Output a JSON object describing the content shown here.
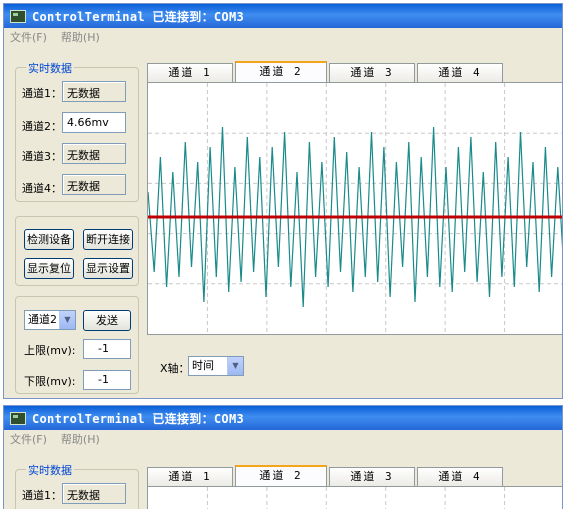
{
  "window": {
    "title": "ControlTerminal 已连接到：COM3",
    "menu": [
      "文件(F)",
      "帮助(H)"
    ]
  },
  "realtime": {
    "group_title": "实时数据",
    "channels": [
      {
        "label": "通道1：",
        "value": "无数据"
      },
      {
        "label": "通道2：",
        "value": "4.66mv"
      },
      {
        "label": "通道3：",
        "value": "无数据"
      },
      {
        "label": "通道4：",
        "value": "无数据"
      }
    ]
  },
  "buttons": {
    "detect": "检测设备",
    "disconnect": "断开连接",
    "reset_display": "显示复位",
    "display_settings": "显示设置",
    "send": "发送"
  },
  "controls": {
    "channel_select": "通道2",
    "upper_label": "上限(mv):",
    "upper_value": "-1",
    "lower_label": "下限(mv):",
    "lower_value": "-1"
  },
  "tabs": [
    "通道 1",
    "通道 2",
    "通道 3",
    "通道 4"
  ],
  "active_tab": 1,
  "xaxis": {
    "label": "X轴：",
    "value": "时间"
  },
  "colors": {
    "signal": "#1a8a8a",
    "baseline": "#c00000",
    "accent_tab": "#f4a51b"
  },
  "chart_data": {
    "type": "line",
    "series": [
      {
        "values": [
          0.25,
          -0.55,
          0.6,
          -0.7,
          0.45,
          -0.6,
          0.75,
          -0.5,
          0.55,
          -0.85,
          0.7,
          -0.6,
          0.9,
          -0.75,
          0.5,
          -0.65,
          0.8,
          -0.55,
          0.6,
          -0.8,
          0.7,
          -0.5,
          0.85,
          -0.7,
          0.45,
          -0.9,
          0.75,
          -0.6,
          0.55,
          -0.7,
          0.8,
          -0.55,
          0.65,
          -0.75,
          0.5,
          -0.6,
          0.85,
          -0.65,
          0.7,
          -0.8,
          0.55,
          -0.5,
          0.75,
          -0.85,
          0.6,
          -0.6,
          0.9,
          -0.7,
          0.5,
          -0.75,
          0.7,
          -0.55,
          0.8,
          -0.65,
          0.45,
          -0.8,
          0.75,
          -0.6,
          0.6,
          -0.7,
          0.85,
          -0.5,
          0.55,
          -0.75,
          0.7,
          -0.6,
          0.5,
          -0.55
        ]
      },
      {
        "values": [
          0,
          0
        ]
      }
    ]
  }
}
